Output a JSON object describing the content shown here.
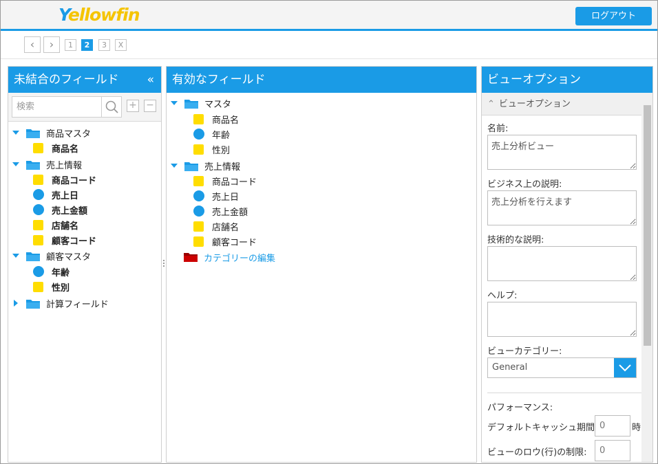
{
  "header": {
    "logo_first": "Y",
    "logo_rest": "ellowfin",
    "logout_label": "ログアウト"
  },
  "steps": [
    "1",
    "2",
    "3",
    "X"
  ],
  "active_step": "2",
  "left_panel": {
    "title": "未結合のフィールド",
    "search_placeholder": "検索",
    "tree": {
      "product_master": {
        "label": "商品マスタ",
        "fields": [
          "商品名"
        ]
      },
      "sales_info": {
        "label": "売上情報",
        "fields": [
          "商品コード",
          "売上日",
          "売上金額",
          "店舗名",
          "顧客コード"
        ]
      },
      "customer_master": {
        "label": "顧客マスタ",
        "fields": [
          "年齢",
          "性別"
        ]
      },
      "calc_fields": {
        "label": "計算フィールド"
      }
    }
  },
  "middle_panel": {
    "title": "有効なフィールド",
    "tree": {
      "master": {
        "label": "マスタ",
        "fields": [
          "商品名",
          "年齢",
          "性別"
        ]
      },
      "sales_info": {
        "label": "売上情報",
        "fields": [
          "商品コード",
          "売上日",
          "売上金額",
          "店舗名",
          "顧客コード"
        ]
      },
      "edit_category": "カテゴリーの編集"
    }
  },
  "right_panel": {
    "title": "ビューオプション",
    "section_title": "ビューオプション",
    "name_label": "名前:",
    "name_value": "売上分析ビュー",
    "business_desc_label": "ビジネス上の説明:",
    "business_desc_value": "売上分析を行えます",
    "technical_desc_label": "技術的な説明:",
    "technical_desc_value": "",
    "help_label": "ヘルプ:",
    "help_value": "",
    "category_label": "ビューカテゴリー:",
    "category_value": "General",
    "performance_label": "パフォーマンス:",
    "cache_label": "デフォルトキャッシュ期間:",
    "cache_value": "0",
    "cache_unit": "時",
    "row_limit_label": "ビューのロウ(行)の制限:",
    "row_limit_value": "0"
  },
  "colors": {
    "accent": "#1a9be6",
    "dimension": "#ffdd00",
    "folder_red": "#cc0000"
  }
}
